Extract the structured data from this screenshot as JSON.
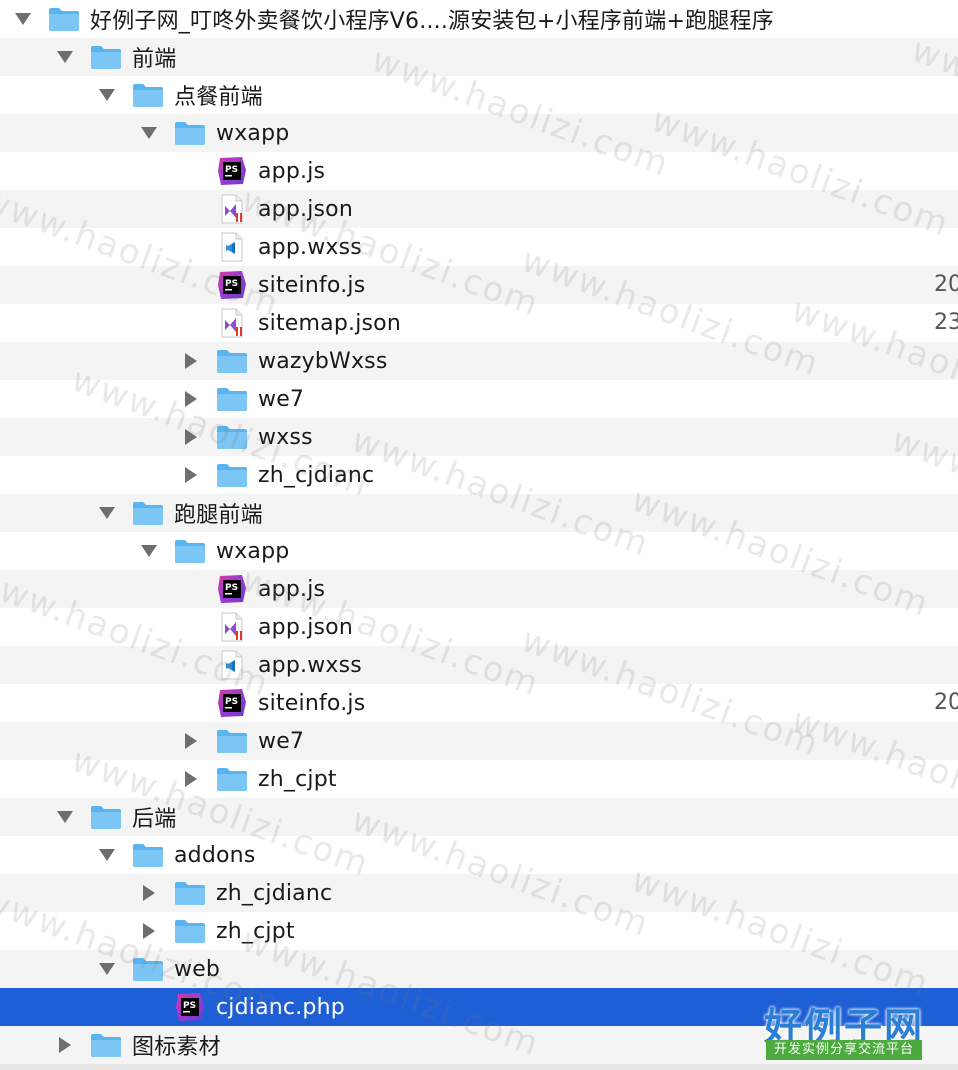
{
  "tree": {
    "rows": [
      {
        "label": "好例子网_叮咚外卖餐饮小程序V6....源安装包+小程序前端+跑腿程序",
        "level": 0,
        "type": "folder",
        "expand": "open",
        "meta": ""
      },
      {
        "label": "前端",
        "level": 1,
        "type": "folder",
        "expand": "open",
        "meta": ""
      },
      {
        "label": "点餐前端",
        "level": 2,
        "type": "folder",
        "expand": "open",
        "meta": ""
      },
      {
        "label": "wxapp",
        "level": 3,
        "type": "folder",
        "expand": "open",
        "meta": ""
      },
      {
        "label": "app.js",
        "level": 4,
        "type": "ps",
        "expand": "none",
        "meta": ""
      },
      {
        "label": "app.json",
        "level": 4,
        "type": "vs",
        "expand": "none",
        "meta": ""
      },
      {
        "label": "app.wxss",
        "level": 4,
        "type": "code",
        "expand": "none",
        "meta": ""
      },
      {
        "label": "siteinfo.js",
        "level": 4,
        "type": "ps",
        "expand": "none",
        "meta": "20"
      },
      {
        "label": "sitemap.json",
        "level": 4,
        "type": "vs",
        "expand": "none",
        "meta": "23"
      },
      {
        "label": "wazybWxss",
        "level": 4,
        "type": "folder",
        "expand": "closed",
        "meta": ""
      },
      {
        "label": "we7",
        "level": 4,
        "type": "folder",
        "expand": "closed",
        "meta": ""
      },
      {
        "label": "wxss",
        "level": 4,
        "type": "folder",
        "expand": "closed",
        "meta": ""
      },
      {
        "label": "zh_cjdianc",
        "level": 4,
        "type": "folder",
        "expand": "closed",
        "meta": ""
      },
      {
        "label": "跑腿前端",
        "level": 2,
        "type": "folder",
        "expand": "open",
        "meta": ""
      },
      {
        "label": "wxapp",
        "level": 3,
        "type": "folder",
        "expand": "open",
        "meta": ""
      },
      {
        "label": "app.js",
        "level": 4,
        "type": "ps",
        "expand": "none",
        "meta": ""
      },
      {
        "label": "app.json",
        "level": 4,
        "type": "vs",
        "expand": "none",
        "meta": ""
      },
      {
        "label": "app.wxss",
        "level": 4,
        "type": "code",
        "expand": "none",
        "meta": ""
      },
      {
        "label": "siteinfo.js",
        "level": 4,
        "type": "ps",
        "expand": "none",
        "meta": "20"
      },
      {
        "label": "we7",
        "level": 4,
        "type": "folder",
        "expand": "closed",
        "meta": ""
      },
      {
        "label": "zh_cjpt",
        "level": 4,
        "type": "folder",
        "expand": "closed",
        "meta": ""
      },
      {
        "label": "后端",
        "level": 1,
        "type": "folder",
        "expand": "open",
        "meta": ""
      },
      {
        "label": "addons",
        "level": 2,
        "type": "folder",
        "expand": "open",
        "meta": ""
      },
      {
        "label": "zh_cjdianc",
        "level": 3,
        "type": "folder",
        "expand": "closed",
        "meta": ""
      },
      {
        "label": "zh_cjpt",
        "level": 3,
        "type": "folder",
        "expand": "closed",
        "meta": ""
      },
      {
        "label": "web",
        "level": 2,
        "type": "folder",
        "expand": "open",
        "meta": ""
      },
      {
        "label": "cjdianc.php",
        "level": 3,
        "type": "ps",
        "expand": "none",
        "meta": "",
        "selected": true
      },
      {
        "label": "图标素材",
        "level": 1,
        "type": "folder",
        "expand": "closed",
        "meta": ""
      }
    ]
  },
  "watermark": {
    "text": "www.haolizi.com"
  },
  "logo": {
    "main": "好例子网",
    "sub": "开发实例分享交流平台"
  },
  "colors": {
    "selection": "#1f5fd6",
    "folder": "#5ab4ef",
    "stripe": "#f4f4f4"
  }
}
